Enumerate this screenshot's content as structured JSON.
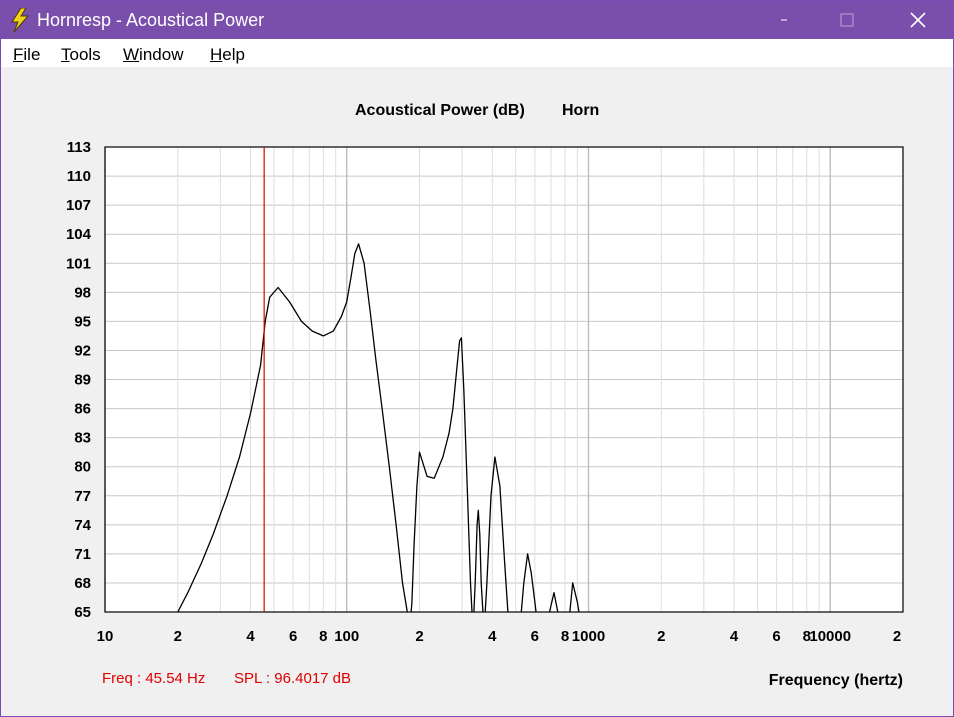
{
  "window": {
    "title": "Hornresp - Acoustical Power",
    "icon": "lightning-icon",
    "controls": [
      "minimize-icon",
      "maximize-icon",
      "close-icon"
    ]
  },
  "menu": [
    "File",
    "Tools",
    "Window",
    "Help"
  ],
  "readout": {
    "freq": "Freq : 45.54 Hz",
    "spl": "SPL : 96.4017 dB"
  },
  "colors": {
    "titlebar": "#7a4fab",
    "curve": "#000000",
    "cursor": "#e00000",
    "grid": "#c8c8c8"
  },
  "chart_data": {
    "type": "line",
    "title": "Acoustical Power (dB)",
    "subtitle": "Horn",
    "xlabel": "Frequency (hertz)",
    "ylabel": "",
    "xscale": "log",
    "xlim": [
      10,
      20000
    ],
    "ylim": [
      65,
      113
    ],
    "grid": true,
    "x_tick_labels": [
      {
        "value": 10,
        "label": "10"
      },
      {
        "value": 20,
        "label": "2"
      },
      {
        "value": 40,
        "label": "4"
      },
      {
        "value": 60,
        "label": "6"
      },
      {
        "value": 80,
        "label": "8"
      },
      {
        "value": 100,
        "label": "100"
      },
      {
        "value": 200,
        "label": "2"
      },
      {
        "value": 400,
        "label": "4"
      },
      {
        "value": 600,
        "label": "6"
      },
      {
        "value": 800,
        "label": "8"
      },
      {
        "value": 1000,
        "label": "1000"
      },
      {
        "value": 2000,
        "label": "2"
      },
      {
        "value": 4000,
        "label": "4"
      },
      {
        "value": 6000,
        "label": "6"
      },
      {
        "value": 8000,
        "label": "8"
      },
      {
        "value": 10000,
        "label": "10000"
      },
      {
        "value": 20000,
        "label": "2"
      }
    ],
    "y_ticks": [
      113,
      110,
      107,
      104,
      101,
      98,
      95,
      92,
      89,
      86,
      83,
      80,
      77,
      74,
      71,
      68,
      65
    ],
    "cursor_x": 45.54,
    "series": [
      {
        "x": [
          20,
          22,
          25,
          28,
          32,
          36,
          40,
          44,
          46,
          48,
          52,
          58,
          65,
          72,
          80,
          88,
          95,
          100,
          104,
          108,
          112,
          118,
          125,
          132,
          140,
          150,
          160,
          170,
          178,
          182,
          186,
          190,
          195,
          200,
          215,
          230,
          250,
          265,
          275,
          285,
          293,
          298,
          305,
          315,
          325,
          333,
          340,
          346,
          350,
          355,
          360,
          370,
          380,
          395,
          410,
          430,
          450,
          470,
          495,
          515,
          540,
          560,
          580,
          600,
          620,
          650,
          690,
          720,
          760,
          790,
          830,
          860,
          900,
          940,
          960,
          980,
          1000,
          1025
        ],
        "y": [
          65,
          67,
          70,
          73,
          77,
          81,
          85.5,
          90.5,
          95,
          97.5,
          98.5,
          97,
          95,
          94,
          93.5,
          94,
          95.5,
          97,
          99.5,
          102,
          103,
          101,
          96,
          91,
          86,
          80,
          74,
          68,
          65,
          63,
          66,
          72,
          78,
          81.5,
          79,
          78.8,
          81,
          83.5,
          86,
          90,
          93,
          93.3,
          88,
          78,
          68,
          63,
          68,
          74,
          75.5,
          73,
          68,
          63,
          68,
          77,
          81,
          78,
          70,
          63,
          60,
          62,
          68,
          71,
          69,
          66,
          63,
          62,
          65,
          67,
          64,
          62,
          64,
          68,
          66,
          63,
          61,
          61,
          62,
          63
        ]
      }
    ]
  }
}
